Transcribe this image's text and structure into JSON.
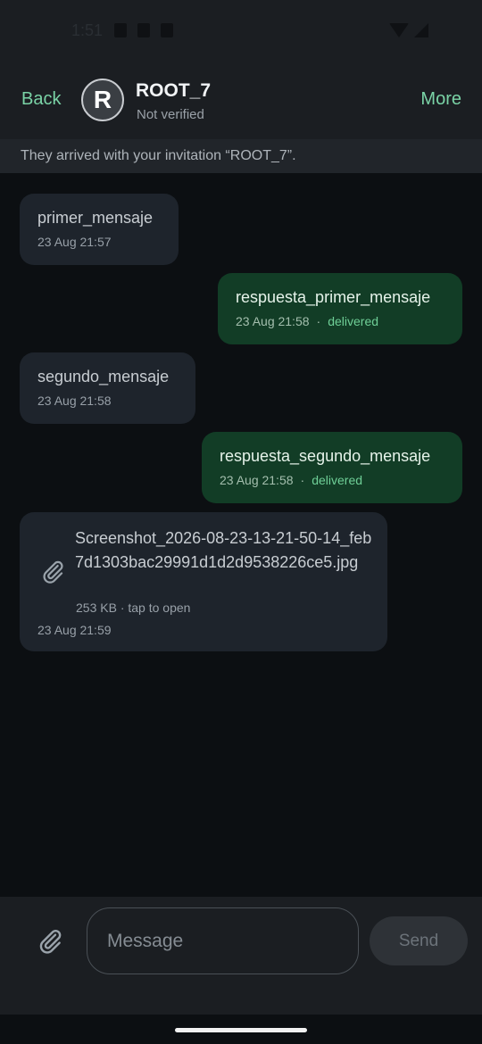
{
  "status_bar": {
    "time": "1:51",
    "icons": [
      "lock-icon",
      "download-icon",
      "sim-card-icon",
      "wifi-icon",
      "signal-icon"
    ]
  },
  "header": {
    "back_label": "Back",
    "more_label": "More",
    "avatar_initial": "R",
    "contact_name": "ROOT_7",
    "contact_status": "Not verified"
  },
  "notice": {
    "text": "They arrived with your invitation “ROOT_7”."
  },
  "messages": [
    {
      "direction": "in",
      "text": "primer_mensaje",
      "time": "23 Aug 21:57"
    },
    {
      "direction": "out",
      "text": "respuesta_primer_mensaje",
      "time": "23 Aug 21:58",
      "separator": "·",
      "status": "delivered"
    },
    {
      "direction": "in",
      "text": "segundo_mensaje",
      "time": "23 Aug 21:58"
    },
    {
      "direction": "out",
      "text": "respuesta_segundo_mensaje",
      "time": "23 Aug 21:58",
      "separator": "·",
      "status": "delivered"
    }
  ],
  "attachment": {
    "file_name": "Screenshot_2026-08-23-13-21-50-14_feb7d1303bac29991d1d2d9538226ce5.jpg",
    "info": "253 KB · tap to open",
    "time": "23 Aug 21:59"
  },
  "composer": {
    "placeholder": "Message",
    "value": "",
    "send_label": "Send"
  },
  "colors": {
    "accent": "#7ad3a6",
    "incoming_bubble": "#1e242c",
    "outgoing_bubble": "#123d26",
    "delivered": "#6fcf97",
    "background": "#0c0f12"
  }
}
